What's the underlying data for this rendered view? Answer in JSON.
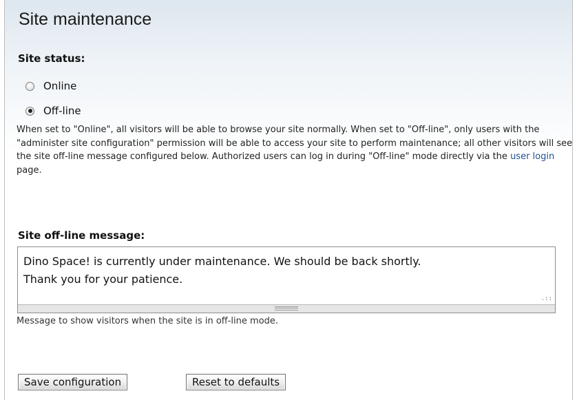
{
  "page": {
    "title": "Site maintenance"
  },
  "site_status": {
    "label": "Site status:",
    "options": [
      {
        "label": "Online",
        "selected": false
      },
      {
        "label": "Off-line",
        "selected": true
      }
    ],
    "description_before_link": "When set to \"Online\", all visitors will be able to browse your site normally. When set to \"Off-line\", only users with the \"administer site configuration\" permission will be able to access your site to perform maintenance; all other visitors will see the site off-line message configured below. Authorized users can log in during \"Off-line\" mode directly via the ",
    "link_text": "user login",
    "description_after_link": " page."
  },
  "offline_message": {
    "label": "Site off-line message:",
    "value": "Dino Space! is currently under maintenance. We should be back shortly.\nThank you for your patience.",
    "help": "Message to show visitors when the site is in off-line mode."
  },
  "actions": {
    "save_label": "Save configuration",
    "reset_label": "Reset to defaults"
  },
  "icons": {
    "resize_handle": "resize-grip-icon",
    "textarea_grippie": "grippie-icon"
  },
  "colors": {
    "link": "#1d4f91",
    "header_gradient_top": "#dde7ef"
  }
}
